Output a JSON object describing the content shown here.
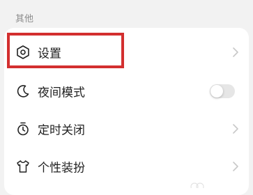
{
  "section": {
    "title": "其他"
  },
  "rows": [
    {
      "label": "设置",
      "icon": "settings-hexagon-icon",
      "control": "chevron-right-icon"
    },
    {
      "label": "夜间模式",
      "icon": "moon-icon",
      "control": "toggle",
      "toggle_on": false
    },
    {
      "label": "定时关闭",
      "icon": "timer-icon",
      "control": "chevron-right-icon"
    },
    {
      "label": "个性装扮",
      "icon": "tshirt-icon",
      "control": "chevron-right-icon"
    }
  ],
  "highlight": {
    "target": "设置",
    "color": "#d32f2f"
  },
  "colors": {
    "background": "#f2f2f2",
    "card": "#ffffff",
    "text": "#222222",
    "muted": "#8c8c8c"
  }
}
